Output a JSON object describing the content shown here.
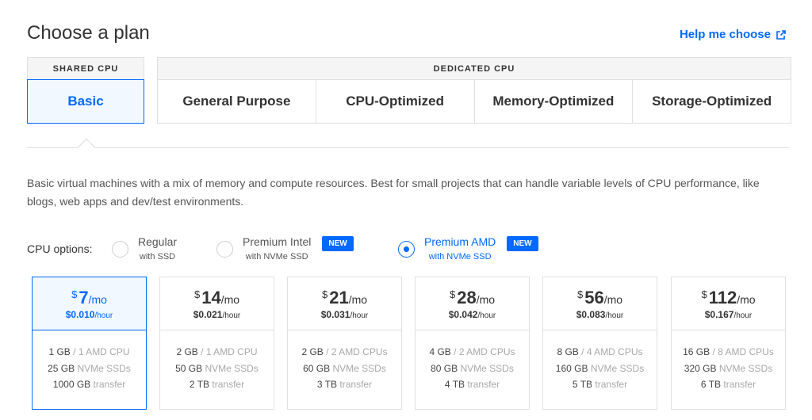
{
  "title": "Choose a plan",
  "help_link": "Help me choose",
  "tabs": {
    "shared_header": "SHARED CPU",
    "basic": "Basic",
    "dedicated_header": "DEDICATED CPU",
    "dedicated": [
      "General Purpose",
      "CPU-Optimized",
      "Memory-Optimized",
      "Storage-Optimized"
    ]
  },
  "description": "Basic virtual machines with a mix of memory and compute resources. Best for small projects that can handle variable levels of CPU performance, like blogs, web apps and dev/test environments.",
  "cpu_options": {
    "label": "CPU options:",
    "options": [
      {
        "main": "Regular",
        "sub": "with SSD",
        "selected": false
      },
      {
        "main": "Premium Intel",
        "sub": "with NVMe SSD",
        "badge": "NEW",
        "selected": false
      },
      {
        "main": "Premium AMD",
        "sub": "with NVMe SSD",
        "badge": "NEW",
        "selected": true
      }
    ]
  },
  "plans": [
    {
      "currency": "$",
      "price": "7",
      "per": "/mo",
      "hourly": "$0.010",
      "hour_unit": "/hour",
      "mem": "1 GB",
      "cpu": "/ 1 AMD CPU",
      "disk": "25 GB",
      "disk_unit": "NVMe SSDs",
      "transfer": "1000 GB",
      "transfer_unit": "transfer",
      "selected": true
    },
    {
      "currency": "$",
      "price": "14",
      "per": "/mo",
      "hourly": "$0.021",
      "hour_unit": "/hour",
      "mem": "2 GB",
      "cpu": "/ 1 AMD CPU",
      "disk": "50 GB",
      "disk_unit": "NVMe SSDs",
      "transfer": "2 TB",
      "transfer_unit": "transfer",
      "selected": false
    },
    {
      "currency": "$",
      "price": "21",
      "per": "/mo",
      "hourly": "$0.031",
      "hour_unit": "/hour",
      "mem": "2 GB",
      "cpu": "/ 2 AMD CPUs",
      "disk": "60 GB",
      "disk_unit": "NVMe SSDs",
      "transfer": "3 TB",
      "transfer_unit": "transfer",
      "selected": false
    },
    {
      "currency": "$",
      "price": "28",
      "per": "/mo",
      "hourly": "$0.042",
      "hour_unit": "/hour",
      "mem": "4 GB",
      "cpu": "/ 2 AMD CPUs",
      "disk": "80 GB",
      "disk_unit": "NVMe SSDs",
      "transfer": "4 TB",
      "transfer_unit": "transfer",
      "selected": false
    },
    {
      "currency": "$",
      "price": "56",
      "per": "/mo",
      "hourly": "$0.083",
      "hour_unit": "/hour",
      "mem": "8 GB",
      "cpu": "/ 4 AMD CPUs",
      "disk": "160 GB",
      "disk_unit": "NVMe SSDs",
      "transfer": "5 TB",
      "transfer_unit": "transfer",
      "selected": false
    },
    {
      "currency": "$",
      "price": "112",
      "per": "/mo",
      "hourly": "$0.167",
      "hour_unit": "/hour",
      "mem": "16 GB",
      "cpu": "/ 8 AMD CPUs",
      "disk": "320 GB",
      "disk_unit": "NVMe SSDs",
      "transfer": "6 TB",
      "transfer_unit": "transfer",
      "selected": false
    }
  ],
  "colors": {
    "accent": "#0069ff",
    "selected_bg": "#f2f8ff",
    "border": "#e0e0e0"
  },
  "icons": {
    "help": "external-link-icon"
  }
}
